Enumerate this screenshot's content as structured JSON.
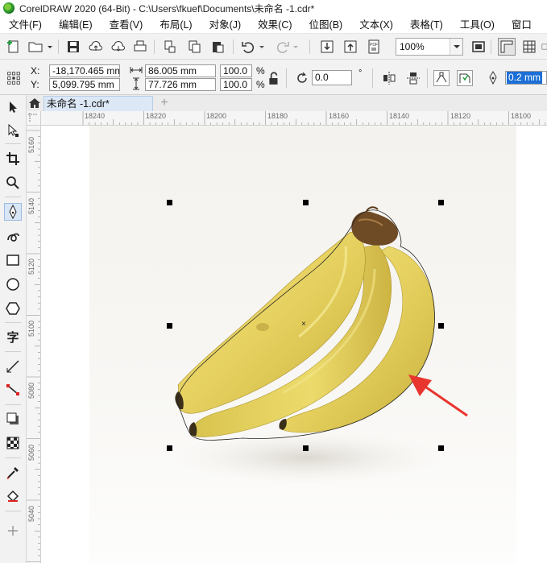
{
  "window": {
    "title": "CorelDRAW 2020 (64-Bit) - C:\\Users\\fkuef\\Documents\\未命名 -1.cdr*"
  },
  "menu": {
    "items": [
      {
        "label": "文件(F)"
      },
      {
        "label": "编辑(E)"
      },
      {
        "label": "查看(V)"
      },
      {
        "label": "布局(L)"
      },
      {
        "label": "对象(J)"
      },
      {
        "label": "效果(C)"
      },
      {
        "label": "位图(B)"
      },
      {
        "label": "文本(X)"
      },
      {
        "label": "表格(T)"
      },
      {
        "label": "工具(O)"
      },
      {
        "label": "窗口"
      }
    ]
  },
  "toolbar": {
    "zoom_value": "100%",
    "pdf_label": "PDF"
  },
  "properties": {
    "x_label": "X:",
    "y_label": "Y:",
    "x_value": "-18,170.465 mm",
    "y_value": "5,099.795 mm",
    "width_value": "86.005 mm",
    "height_value": "77.726 mm",
    "scale_w": "100.0",
    "scale_h": "100.0",
    "percent": "%",
    "rotation": "0.0",
    "degree": "°",
    "outline_width": "0.2 mm"
  },
  "document": {
    "tab_label": "未命名 -1.cdr*",
    "new_tab_label": "+"
  },
  "ruler": {
    "h_labels": [
      "18240",
      "18220",
      "18200",
      "18180",
      "18160",
      "18140",
      "18120",
      "18100"
    ],
    "v_labels": [
      "5160",
      "5140",
      "5120",
      "5100",
      "5080",
      "5060",
      "5040"
    ]
  },
  "canvas": {
    "center_mark": "×",
    "arrow_color": "#e8352e",
    "selection_color": "#000000"
  },
  "icons": [
    "app-logo-icon",
    "new-document-icon",
    "open-folder-icon",
    "save-icon",
    "cloud-upload-icon",
    "cloud-download-icon",
    "print-icon",
    "copy-icon",
    "paste-icon",
    "clipboard-icon",
    "undo-icon",
    "redo-icon",
    "import-icon",
    "export-icon",
    "pdf-icon",
    "full-screen-icon",
    "rulers-icon",
    "grid-icon"
  ]
}
